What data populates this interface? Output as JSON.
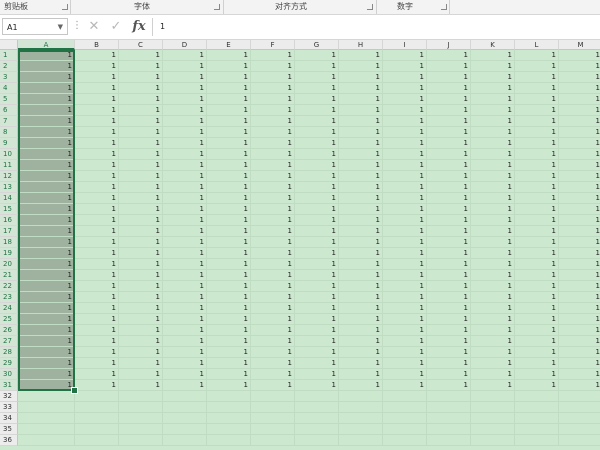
{
  "ribbon": {
    "groups": [
      {
        "label": "剪贴板"
      },
      {
        "label": "字体"
      },
      {
        "label": "对齐方式"
      },
      {
        "label": "数字"
      }
    ]
  },
  "formula_bar": {
    "name_box": "A1",
    "cancel_icon": "✕",
    "enter_icon": "✓",
    "fx_label": "fx",
    "formula_value": "1"
  },
  "sheet": {
    "columns": [
      "A",
      "B",
      "C",
      "D",
      "E",
      "F",
      "G",
      "H",
      "I",
      "J",
      "K",
      "L",
      "M"
    ],
    "selected_column": "A",
    "filled_rows": 31,
    "total_rows": 36,
    "cell_value": "1",
    "selected_range": "A1:A31"
  },
  "colors": {
    "eye_protect_bg": "#cce8cf",
    "selection_fill": "#9fb19f",
    "accent": "#217346"
  }
}
